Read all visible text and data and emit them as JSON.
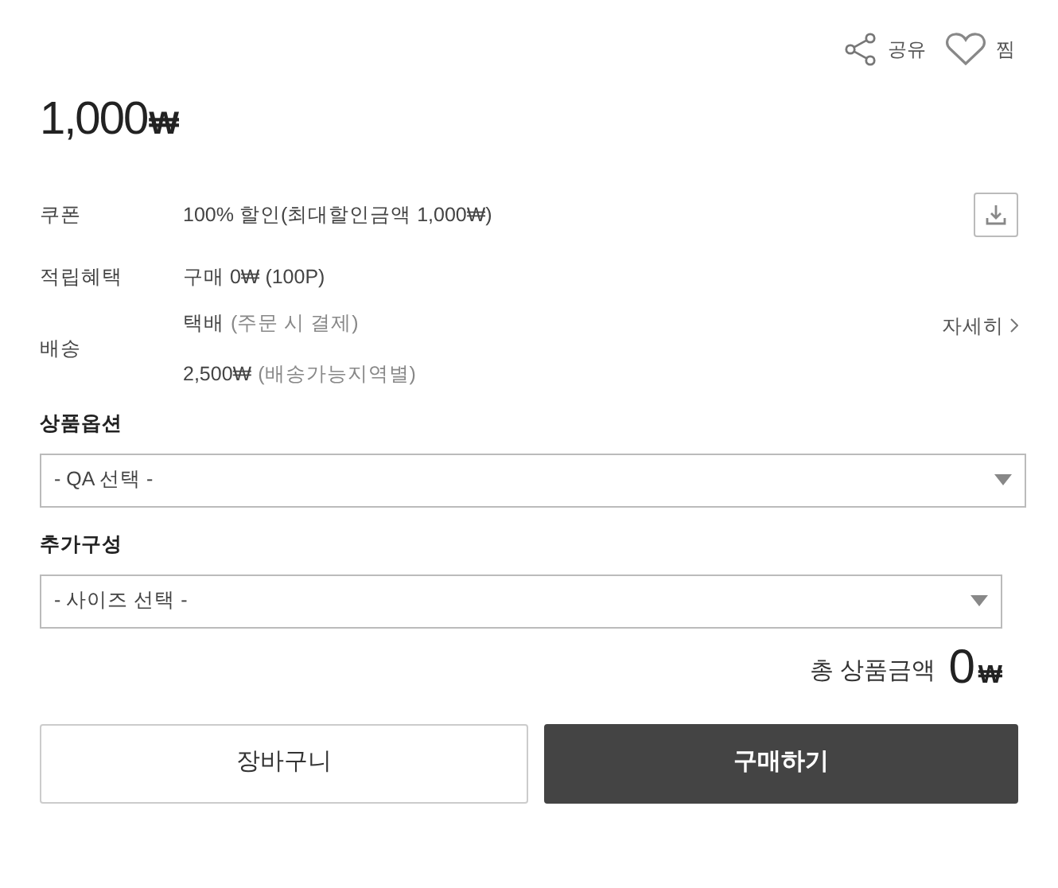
{
  "actions": [
    {
      "kind": "share",
      "label": "공유"
    },
    {
      "kind": "wish",
      "label": "찜"
    }
  ],
  "price": {
    "amount": "1,000",
    "currency": "₩"
  },
  "info": [
    {
      "label": "쿠폰",
      "lines": [
        {
          "main": "100% 할인(최대할인금액 1,000₩)"
        }
      ],
      "download": true
    },
    {
      "label": "적립혜택",
      "lines": [
        {
          "main": "구매 0₩ (100P)"
        }
      ]
    },
    {
      "label": "배송",
      "lines": [
        {
          "main": "택배",
          "note": "(주문 시 결제)"
        },
        {
          "main": "2,500₩",
          "note": "(배송가능지역별)"
        }
      ],
      "link": "자세히"
    }
  ],
  "options": [
    {
      "label": "상품옵션",
      "value": "- QA 선택 -",
      "wide": true
    },
    {
      "label": "추가구성",
      "value": "- 사이즈 선택 -",
      "wide": false
    }
  ],
  "total": {
    "label": "총 상품금액",
    "amount": "0",
    "currency": "₩"
  },
  "buttons": [
    {
      "kind": "secondary",
      "label": "장바구니"
    },
    {
      "kind": "primary",
      "label": "구매하기"
    }
  ]
}
